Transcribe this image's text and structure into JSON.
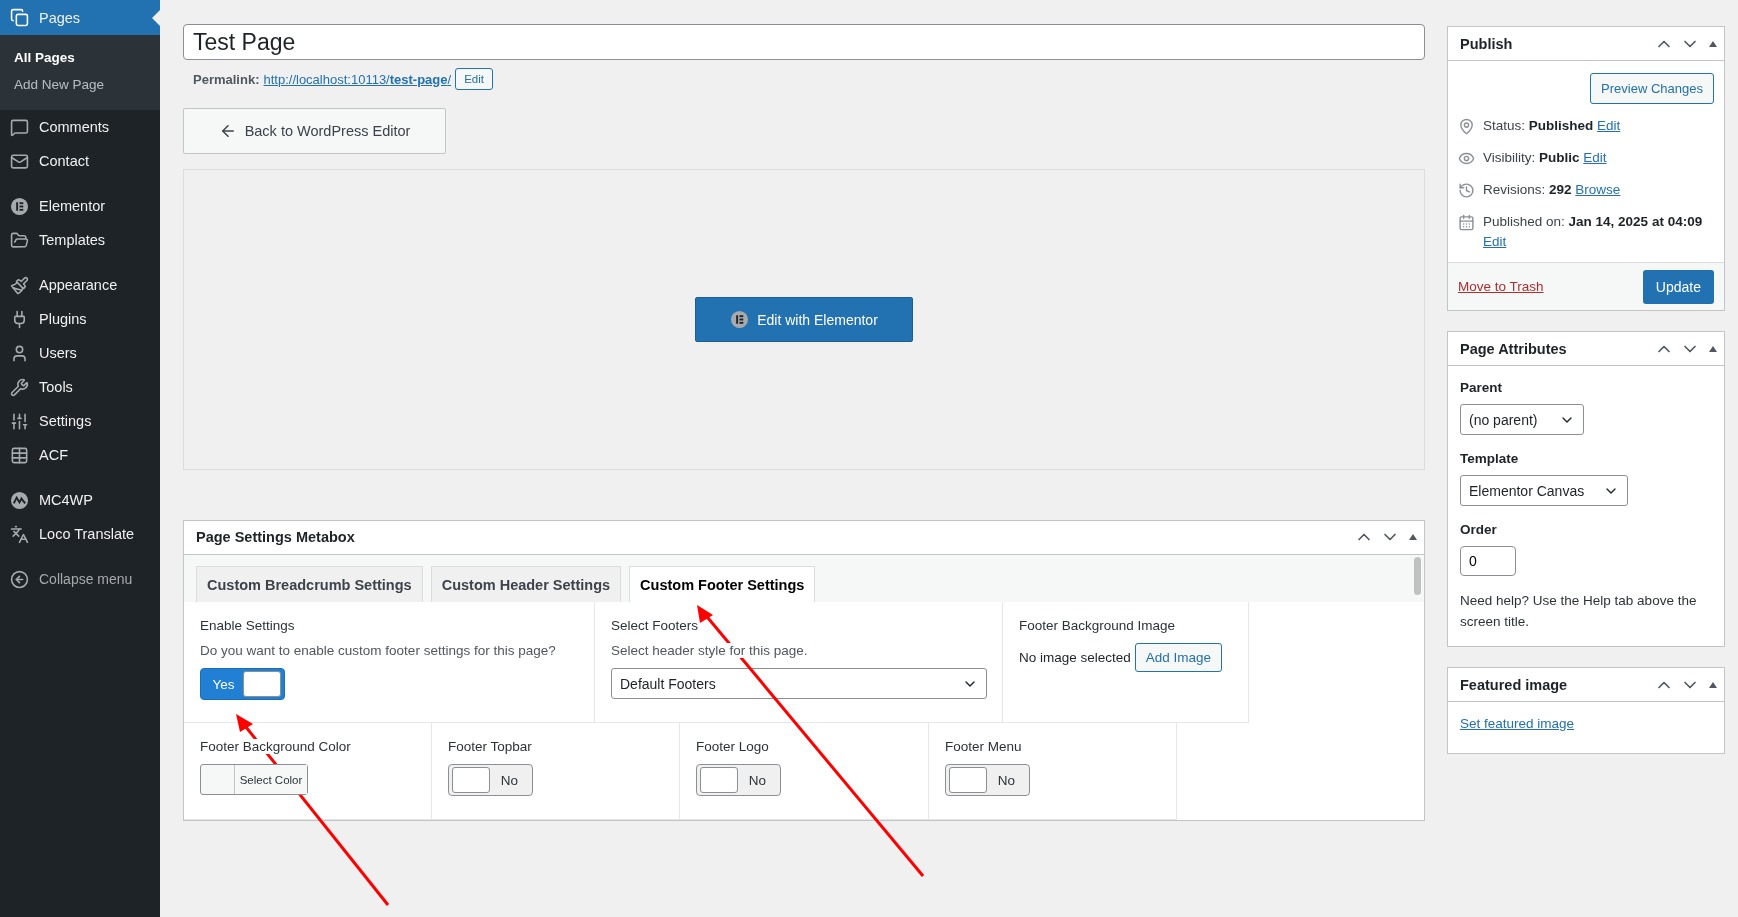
{
  "sidebar": {
    "groups": [
      {
        "items": [
          {
            "label": "Pages",
            "selected": true,
            "children": [
              {
                "label": "All Pages",
                "selected": true
              },
              {
                "label": "Add New Page",
                "selected": false
              }
            ]
          },
          {
            "label": "Comments",
            "selected": false
          },
          {
            "label": "Contact",
            "selected": false
          }
        ]
      },
      {
        "items": [
          {
            "label": "Elementor",
            "selected": false
          },
          {
            "label": "Templates",
            "selected": false
          }
        ]
      },
      {
        "items": [
          {
            "label": "Appearance",
            "selected": false
          },
          {
            "label": "Plugins",
            "selected": false
          },
          {
            "label": "Users",
            "selected": false
          },
          {
            "label": "Tools",
            "selected": false
          },
          {
            "label": "Settings",
            "selected": false
          },
          {
            "label": "ACF",
            "selected": false
          }
        ]
      },
      {
        "items": [
          {
            "label": "MC4WP",
            "selected": false
          },
          {
            "label": "Loco Translate",
            "selected": false
          }
        ]
      }
    ],
    "collapse": "Collapse menu"
  },
  "title_field": {
    "value": "Test Page"
  },
  "permalink": {
    "label": "Permalink:",
    "url": "http://localhost:10113/**test-page**/",
    "edit": "Edit"
  },
  "back_button": "Back to WordPress Editor",
  "elementor_button": "Edit with Elementor",
  "metabox": {
    "title": "Page Settings Metabox",
    "tabs": [
      {
        "label": "Custom Breadcrumb Settings",
        "selected": false
      },
      {
        "label": "Custom Header Settings",
        "selected": false
      },
      {
        "label": "Custom Footer Settings",
        "selected": true
      }
    ],
    "sections": [
      {
        "fields": [
          {
            "kind": "toggle",
            "label": "Enable Settings",
            "description": "Do you want to enable custom footer settings for this page?",
            "toggle": {
              "text": "Yes",
              "on": true
            }
          },
          {
            "kind": "select",
            "label": "Select Footers",
            "description": "Select header style for this page.",
            "value": "Default Footers"
          },
          {
            "kind": "image",
            "label": "Footer Background Image",
            "status": "No image selected",
            "button": "Add Image"
          }
        ]
      },
      {
        "fields": [
          {
            "kind": "color",
            "label": "Footer Background Color",
            "button": "Select Color"
          },
          {
            "kind": "toggle",
            "label": "Footer Topbar",
            "toggle": {
              "text": "No",
              "on": false
            }
          },
          {
            "kind": "toggle",
            "label": "Footer Logo",
            "toggle": {
              "text": "No",
              "on": false
            }
          },
          {
            "kind": "toggle",
            "label": "Footer Menu",
            "toggle": {
              "text": "No",
              "on": false
            }
          }
        ]
      }
    ]
  },
  "publish": {
    "title": "Publish",
    "preview": "Preview Changes",
    "rows": [
      {
        "text": "Status: **Published**",
        "link": "Edit"
      },
      {
        "text": "Visibility: **Public**",
        "link": "Edit"
      },
      {
        "text": "Revisions: **292**",
        "link": "Browse"
      },
      {
        "text": "Published on: **Jan 14, 2025 at 04:09**",
        "link": "Edit"
      }
    ],
    "trash": "Move to Trash",
    "update": "Update"
  },
  "page_attributes": {
    "title": "Page Attributes",
    "parent_label": "Parent",
    "parent": "(no parent)",
    "template_label": "Template",
    "template": "Elementor Canvas",
    "order_label": "Order",
    "order": "0",
    "help": "Need help? Use the Help tab above the screen title."
  },
  "featured_image": {
    "title": "Featured image",
    "link": "Set featured image"
  }
}
